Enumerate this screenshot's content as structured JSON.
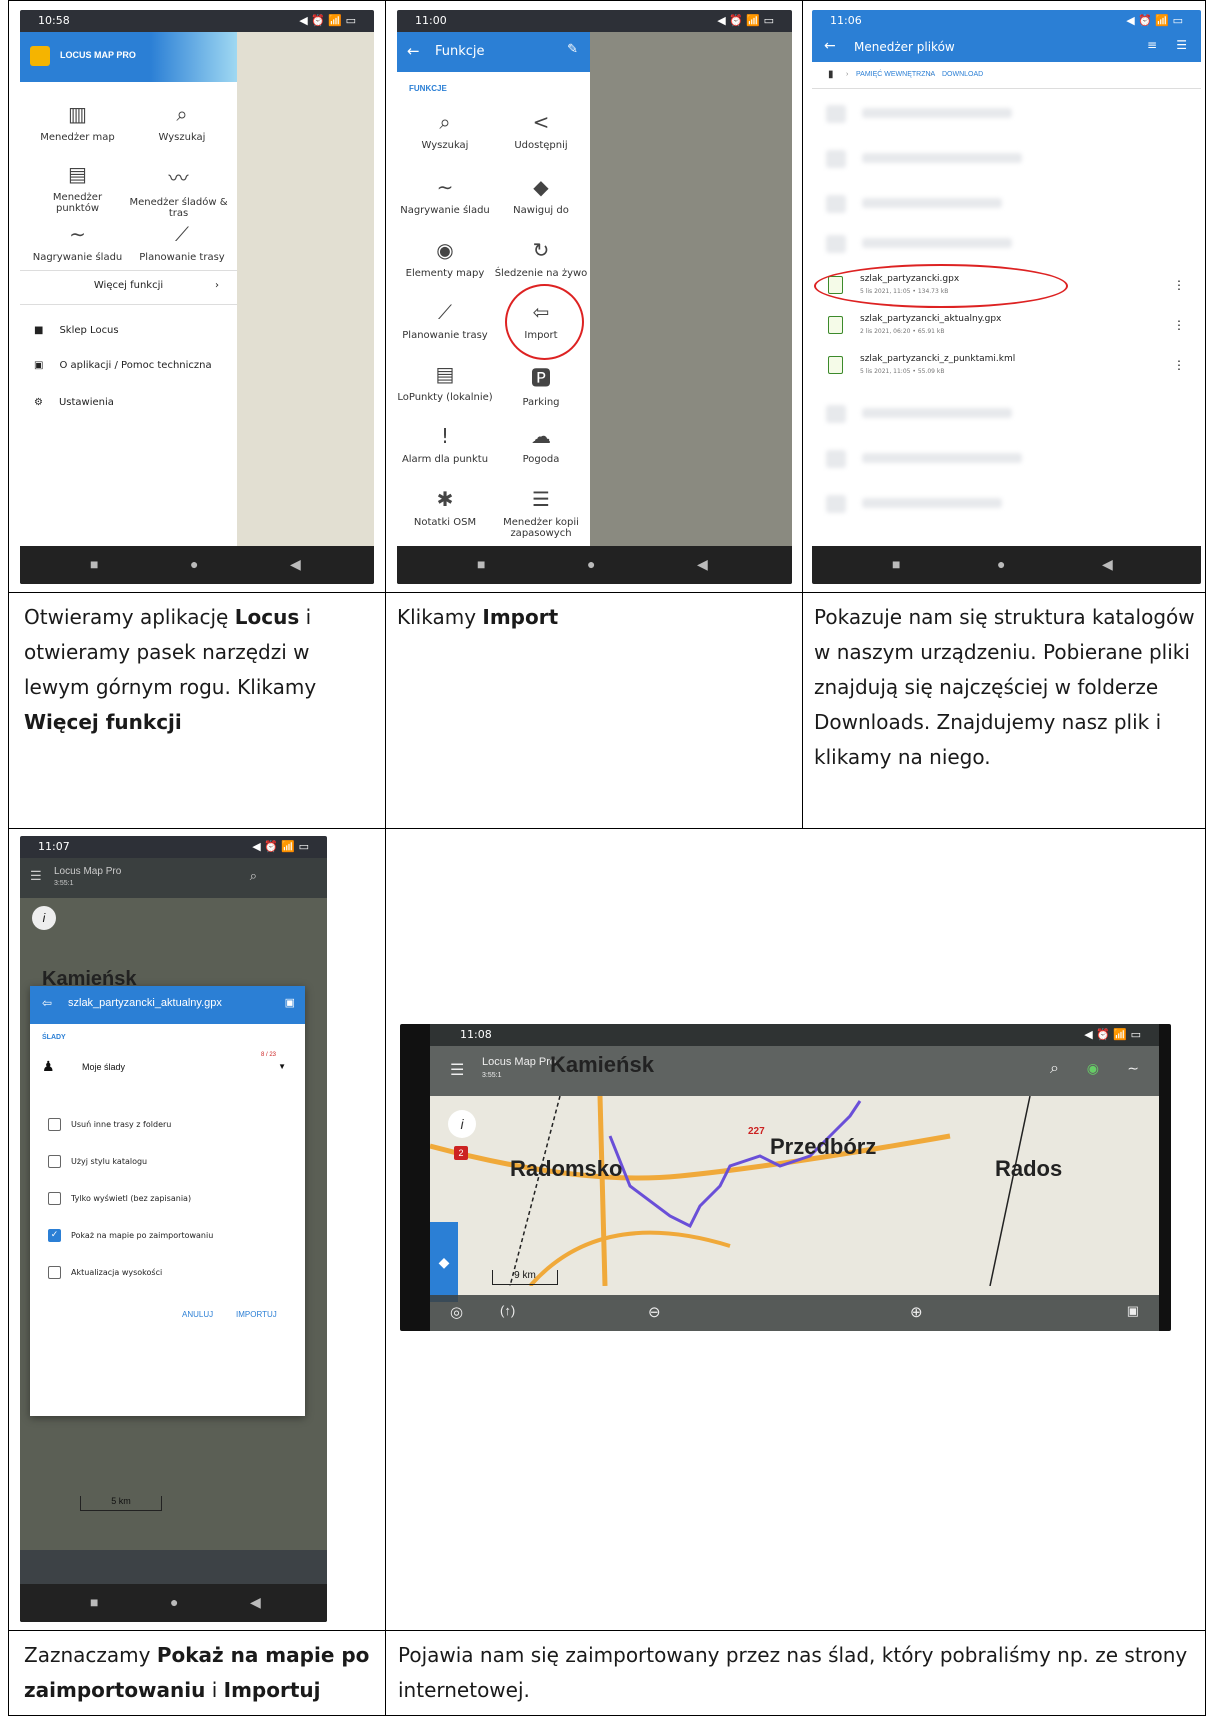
{
  "cells": [
    {
      "screen": {
        "time": "10:58",
        "app_title": "LOCUS MAP PRO",
        "items": [
          "Menedżer map",
          "Wyszukaj",
          "Menedżer punktów",
          "Menedżer śladów & tras",
          "Nagrywanie śladu",
          "Planowanie trasy"
        ],
        "more": "Więcej funkcji",
        "list": [
          "Sklep Locus",
          "O aplikacji / Pomoc techniczna",
          "Ustawienia"
        ]
      },
      "caption_parts": [
        "Otwieramy aplikację ",
        "Locus",
        " i otwieramy pasek narzędzi w lewym górnym rogu. Klikamy ",
        "Więcej funkcji"
      ]
    },
    {
      "screen": {
        "time": "11:00",
        "title": "Funkcje",
        "section": "FUNKCJE",
        "items": [
          "Wyszukaj",
          "Udostępnij",
          "Nagrywanie śladu",
          "Nawiguj do",
          "Elementy mapy",
          "Śledzenie na żywo",
          "Planowanie trasy",
          "Import",
          "LoPunkty (lokalnie)",
          "Parking",
          "Alarm dla punktu",
          "Pogoda",
          "Notatki OSM",
          "Menedżer kopii zapasowych"
        ]
      },
      "caption_parts": [
        "Klikamy ",
        "Import"
      ]
    },
    {
      "screen": {
        "time": "11:06",
        "title": "Menedżer plików",
        "crumbs": [
          "PAMIĘĆ WEWNĘTRZNA",
          "DOWNLOAD"
        ],
        "files": [
          {
            "name": "szlak_partyzancki.gpx",
            "meta": "5 lis 2021, 11:05 • 134.73 kB"
          },
          {
            "name": "szlak_partyzancki_aktualny.gpx",
            "meta": "2 lis 2021, 06:20 • 65.91 kB"
          },
          {
            "name": "szlak_partyzancki_z_punktami.kml",
            "meta": "5 lis 2021, 11:05 • 55.09 kB"
          }
        ]
      },
      "caption": "Pokazuje nam się struktura katalogów w naszym urządzeniu. Pobierane pliki znajdują się najczęściej w folderze Downloads. Znajdujemy nasz plik i klikamy na niego."
    },
    {
      "screen": {
        "time": "11:07",
        "app": "Locus Map Pro",
        "scale_top": "3:55:1",
        "town": "Kamieńsk",
        "dialog_title": "szlak_partyzancki_aktualny.gpx",
        "section": "ŚLADY",
        "folder": "Moje ślady",
        "count": "8 / 23",
        "options": [
          {
            "label": "Usuń inne trasy z folderu",
            "checked": false
          },
          {
            "label": "Użyj stylu katalogu",
            "checked": false
          },
          {
            "label": "Tylko wyświetl (bez zapisania)",
            "checked": false
          },
          {
            "label": "Pokaż na mapie po zaimportowaniu",
            "checked": true
          },
          {
            "label": "Aktualizacja wysokości",
            "checked": false
          }
        ],
        "cancel": "ANULUJ",
        "ok": "IMPORTUJ",
        "scale": "5 km"
      },
      "caption_parts": [
        "Zaznaczamy ",
        "Pokaż na mapie po zaimportowaniu",
        " i ",
        "Importuj"
      ]
    },
    {
      "screen": {
        "time": "11:08",
        "app": "Locus Map Pro",
        "scale_top": "3:55:1",
        "towns": [
          "Kamieńsk",
          "Radomsko",
          "Przedbórz",
          "Rados"
        ],
        "marker": "227",
        "info_badge": "2",
        "scale": "9 km"
      },
      "caption": "Pojawia nam się zaimportowany przez nas ślad, który pobraliśmy np. ze strony internetowej."
    }
  ]
}
